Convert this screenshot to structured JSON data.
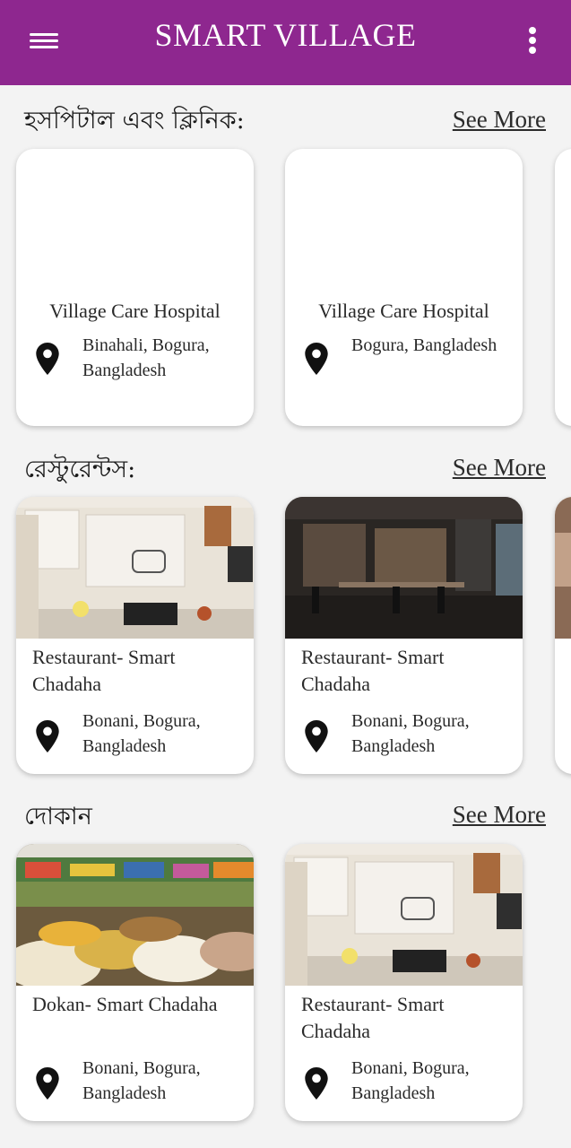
{
  "app": {
    "title": "SMART VILLAGE"
  },
  "sections": [
    {
      "title": "হসপিটাল এবং ক্লিনিক:",
      "see_more": "See More",
      "cards": [
        {
          "name": "Village Care Hospital",
          "address": "Binahali, Bogura, Bangladesh"
        },
        {
          "name": "Village Care Hospital",
          "address": "Bogura, Bangladesh"
        }
      ]
    },
    {
      "title": "রেস্টুরেন্টস:",
      "see_more": "See More",
      "cards": [
        {
          "name": "Restaurant- Smart Chadaha",
          "address": "Bonani, Bogura, Bangladesh"
        },
        {
          "name": "Restaurant- Smart Chadaha",
          "address": "Bonani, Bogura, Bangladesh"
        }
      ]
    },
    {
      "title": "দোকান",
      "see_more": "See More",
      "cards": [
        {
          "name": "Dokan- Smart Chadaha",
          "address": "Bonani, Bogura, Bangladesh"
        },
        {
          "name": "Restaurant- Smart Chadaha",
          "address": "Bonani, Bogura, Bangladesh"
        }
      ]
    }
  ],
  "icons": {
    "menu": "hamburger-menu-icon",
    "more": "more-vert-icon",
    "location": "location-pin-icon"
  },
  "colors": {
    "appbar": "#8e278f",
    "background": "#f3f3f3",
    "card": "#ffffff"
  }
}
